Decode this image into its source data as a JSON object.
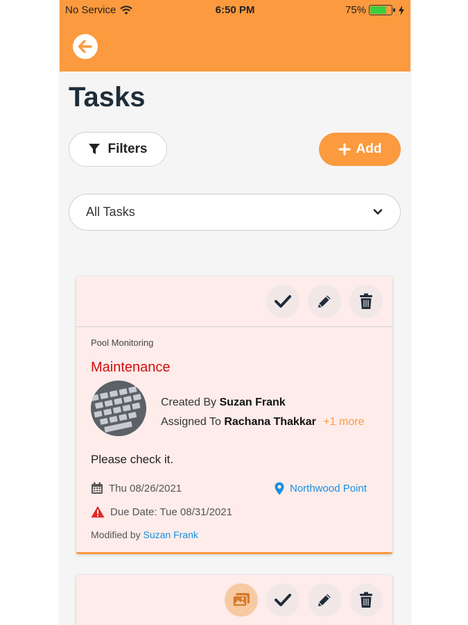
{
  "status_bar": {
    "carrier": "No Service",
    "time": "6:50 PM",
    "battery_percent": "75%",
    "battery_level": 0.75
  },
  "page": {
    "title": "Tasks",
    "filters_label": "Filters",
    "add_label": "Add",
    "select_value": "All Tasks"
  },
  "tasks": [
    {
      "category": "Pool Monitoring",
      "title": "Maintenance",
      "created_by_prefix": "Created By",
      "created_by": "Suzan Frank",
      "assigned_to_prefix": "Assigned To",
      "assigned_to": "Rachana Thakkar",
      "assigned_more": "+1 more",
      "description": "Please check it.",
      "date": "Thu 08/26/2021",
      "location": "Northwood Point",
      "due_date": "Due Date: Tue 08/31/2021",
      "modified_by_prefix": "Modified by",
      "modified_by": "Suzan Frank"
    }
  ],
  "colors": {
    "accent": "#fb9a3e",
    "title_red": "#d30d0d",
    "link_blue": "#1a8fe0",
    "card_bg": "#fdecea"
  }
}
